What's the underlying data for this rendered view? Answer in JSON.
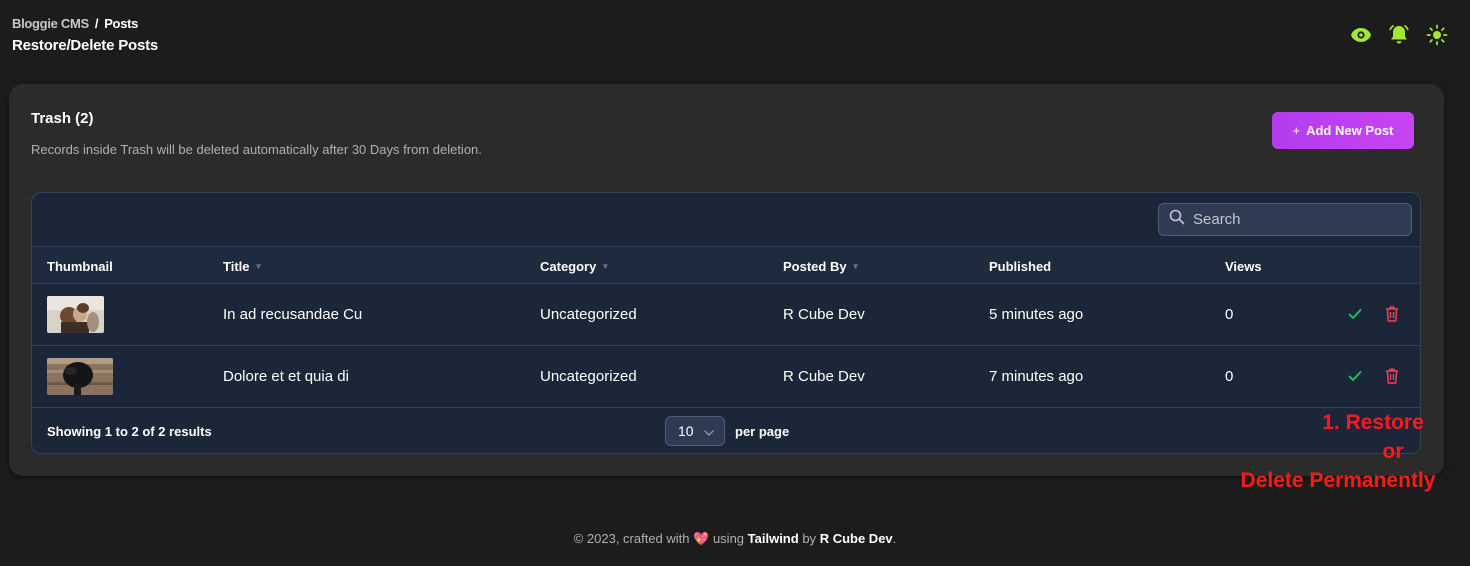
{
  "breadcrumb": {
    "root": "Bloggie CMS",
    "separator": "/",
    "current": "Posts"
  },
  "page_title": "Restore/Delete Posts",
  "top_icons": [
    "eye-icon",
    "bell-icon",
    "sun-icon"
  ],
  "colors": {
    "accent_green": "#a3e635",
    "button_purple": "#c044f2",
    "restore_green": "#22c55e",
    "delete_red": "#f43f5e",
    "annotation_red": "#ff1a1a"
  },
  "card": {
    "title": "Trash (2)",
    "subtitle": "Records inside Trash will be deleted automatically after 30 Days from deletion.",
    "add_button": {
      "icon": "+",
      "label": "Add New Post"
    }
  },
  "search": {
    "placeholder": "Search",
    "value": ""
  },
  "table": {
    "columns": [
      "Thumbnail",
      "Title",
      "Category",
      "Posted By",
      "Published",
      "Views"
    ],
    "rows": [
      {
        "title": "In ad recusandae Cu",
        "category": "Uncategorized",
        "posted_by": "R Cube Dev",
        "published": "5 minutes ago",
        "views": "0"
      },
      {
        "title": "Dolore et et quia di",
        "category": "Uncategorized",
        "posted_by": "R Cube Dev",
        "published": "7 minutes ago",
        "views": "0"
      }
    ]
  },
  "pagination": {
    "showing": "Showing 1 to 2 of 2 results",
    "per_page_value": "10",
    "per_page_label": "per page"
  },
  "annotation": {
    "line1": "1. Restore",
    "line2": "or",
    "line3": "Delete Permanently"
  },
  "footer": {
    "prefix": "© 2023, crafted with",
    "heart": "💖",
    "using": "using",
    "tech": "Tailwind",
    "by": "by",
    "author": "R Cube Dev",
    "suffix": "."
  }
}
